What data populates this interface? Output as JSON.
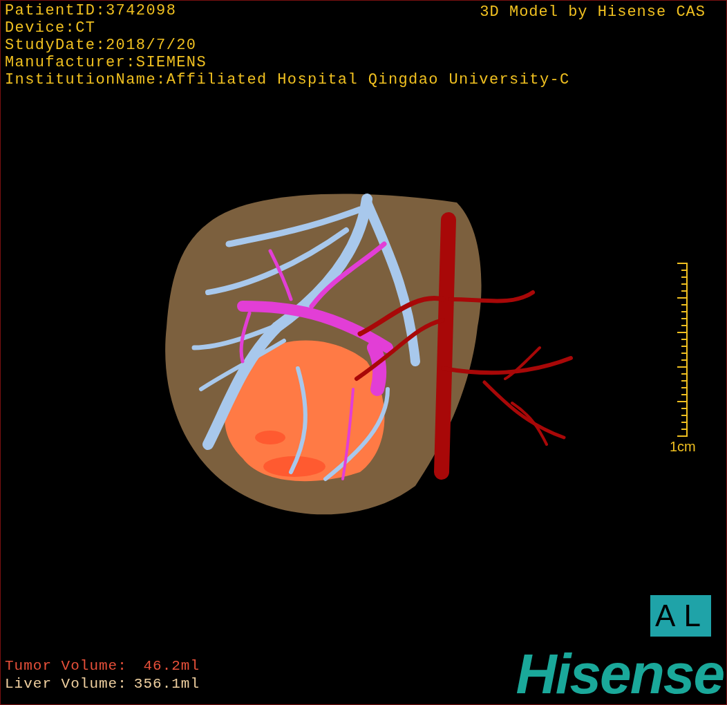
{
  "study_info": [
    "PatientID:3742098",
    "Device:CT",
    "StudyDate:2018/7/20",
    "Manufacturer:SIEMENS",
    "InstitutionName:Affiliated Hospital Qingdao University-C"
  ],
  "header_title": "3D Model by Hisense CAS",
  "scale": {
    "label": "1cm"
  },
  "volumes": [
    {
      "label": "Tumor Volume:",
      "value": "46.2ml",
      "color": "#e8503a"
    },
    {
      "label": "Liver Volume:",
      "value": "356.1ml",
      "color": "#f0d0a0"
    }
  ],
  "orientation_badge": "AL",
  "logo": "Hisense"
}
